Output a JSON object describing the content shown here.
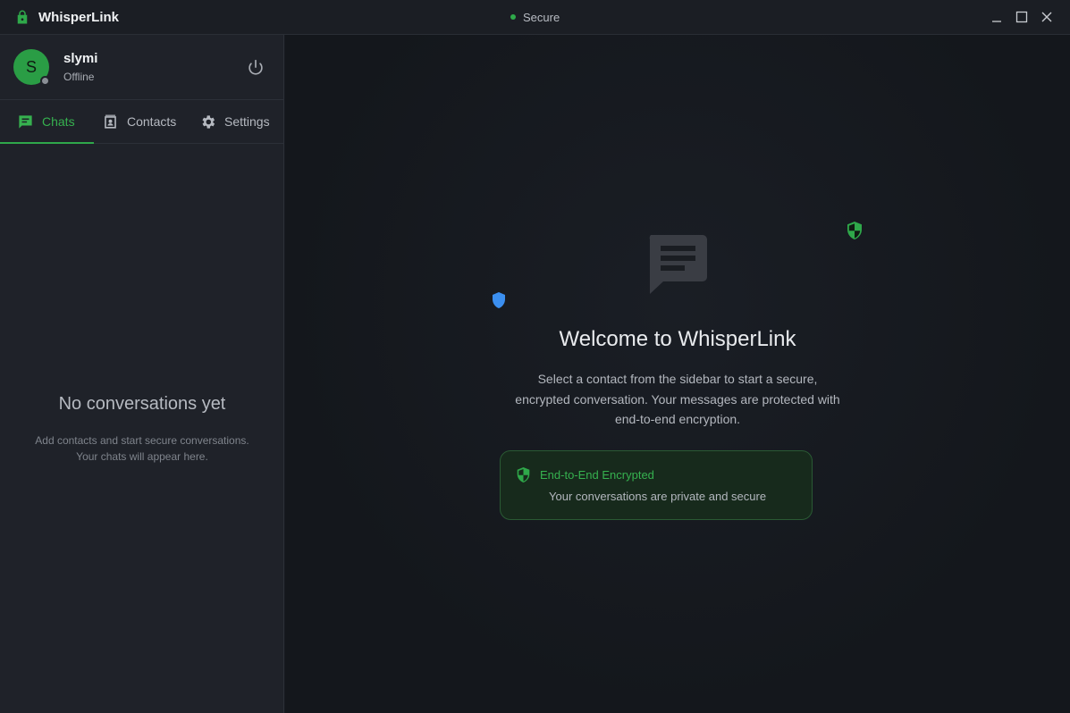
{
  "window": {
    "app_title": "WhisperLink",
    "secure_status": "Secure"
  },
  "profile": {
    "avatar_initial": "S",
    "username": "slymi",
    "status": "Offline"
  },
  "tabs": [
    {
      "label": "Chats",
      "icon": "chat-icon",
      "active": true
    },
    {
      "label": "Contacts",
      "icon": "contact-card-icon",
      "active": false
    },
    {
      "label": "Settings",
      "icon": "gear-icon",
      "active": false
    }
  ],
  "sidebar": {
    "empty_title": "No conversations yet",
    "empty_line1": "Add contacts and start secure conversations.",
    "empty_line2": "Your chats will appear here."
  },
  "welcome": {
    "title": "Welcome to WhisperLink",
    "line1": "Select a contact from the sidebar to start a secure,",
    "line2": "encrypted conversation. Your messages are protected with",
    "line3": "end-to-end encryption."
  },
  "encryption_card": {
    "title": "End-to-End Encrypted",
    "description": "Your conversations are private and secure"
  },
  "colors": {
    "accent": "#2fa84a",
    "background": "#16191f",
    "sidebar": "#1f2229",
    "shield_blue": "#3b8ff0"
  }
}
